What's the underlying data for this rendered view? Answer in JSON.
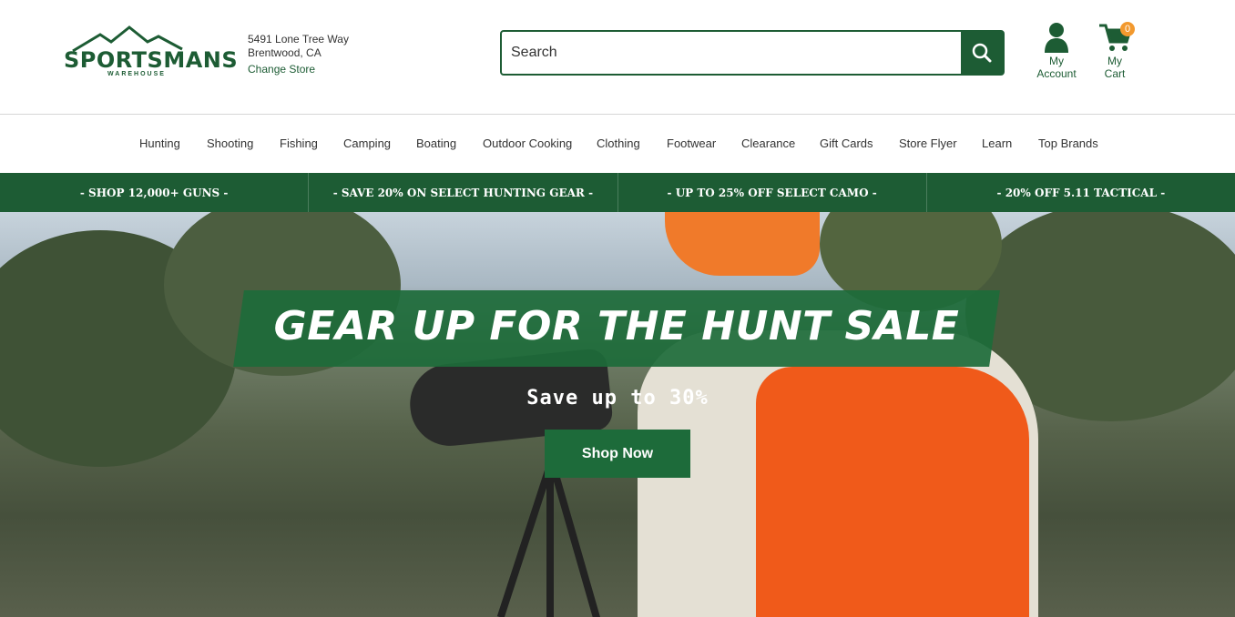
{
  "header": {
    "logo_text": "SPORTSMANS",
    "logo_sub": "WAREHOUSE",
    "store_address_line1": "5491 Lone Tree Way",
    "store_address_line2": "Brentwood, CA",
    "change_store_label": "Change Store",
    "search_placeholder": "Search",
    "account_label_1": "My",
    "account_label_2": "Account",
    "cart_label_1": "My",
    "cart_label_2": "Cart",
    "cart_count": "0"
  },
  "nav": {
    "items": [
      "Hunting",
      "Shooting",
      "Fishing",
      "Camping",
      "Boating",
      "Outdoor Cooking",
      "Clothing",
      "Footwear",
      "Clearance",
      "Gift Cards",
      "Store Flyer",
      "Learn",
      "Top Brands"
    ]
  },
  "promo": {
    "items": [
      "- SHOP 12,000+ GUNS -",
      "- SAVE 20% ON SELECT HUNTING GEAR -",
      "- UP TO 25% OFF SELECT CAMO -",
      "- 20% OFF 5.11 TACTICAL -"
    ]
  },
  "hero": {
    "title": "GEAR UP FOR THE HUNT SALE",
    "subtitle": "Save up to 30%",
    "cta": "Shop Now"
  },
  "colors": {
    "brand_green": "#1d5c34",
    "badge_orange": "#f2992e"
  },
  "icons": [
    "logo-mountain-icon",
    "search-icon",
    "user-icon",
    "cart-icon"
  ]
}
